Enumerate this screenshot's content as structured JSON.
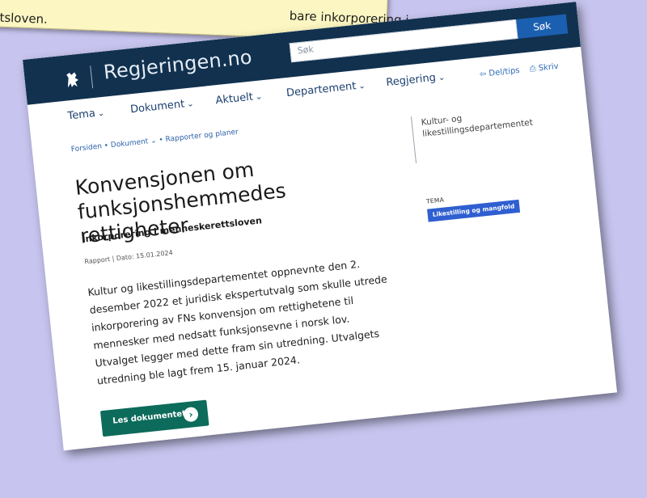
{
  "note": {
    "line1": "bare inkorporering i",
    "line2": "tsloven."
  },
  "header": {
    "site_name": "Regjeringen.no",
    "search_placeholder": "Søk",
    "search_button": "Søk"
  },
  "nav": {
    "items": [
      {
        "label": "Tema"
      },
      {
        "label": "Dokument"
      },
      {
        "label": "Aktuelt"
      },
      {
        "label": "Departement"
      },
      {
        "label": "Regjering"
      }
    ],
    "share_label": "Del/tips",
    "print_label": "Skriv"
  },
  "breadcrumb": {
    "items": [
      "Forsiden",
      "Dokument",
      "Rapporter og planer"
    ]
  },
  "article": {
    "title": "Konvensjonen om funksjonshemmedes rettigheter",
    "subtitle": "Inkorporering i menneskerettsloven",
    "meta": "Rapport | Dato: 15.01.2024",
    "lead": "Kultur og likestillingsdepartementet oppnevnte den 2. desember 2022 et juridisk ekspertutvalg som skulle utrede inkorporering av FNs konvensjon om rettighetene til mennesker med nedsatt funksjonsevne i norsk lov. Utvalget legger med dette fram sin utredning. Utvalgets utredning ble lagt frem 15. januar 2024.",
    "cta_label": "Les dokumentet"
  },
  "sidebar": {
    "department": "Kultur- og likestillingsdepartementet",
    "tema_label": "TEMA",
    "tema_tag": "Likestilling og mangfold"
  },
  "colors": {
    "background": "#c7c5ef",
    "header": "#11314f",
    "accent_button": "#0d6b5b",
    "tag": "#2f5fd0",
    "note": "#fbf6c2"
  },
  "icons": {
    "logo": "norwegian-lion-icon",
    "cta": "arrow-right-circle-icon",
    "share": "share-icon",
    "print": "print-icon"
  }
}
